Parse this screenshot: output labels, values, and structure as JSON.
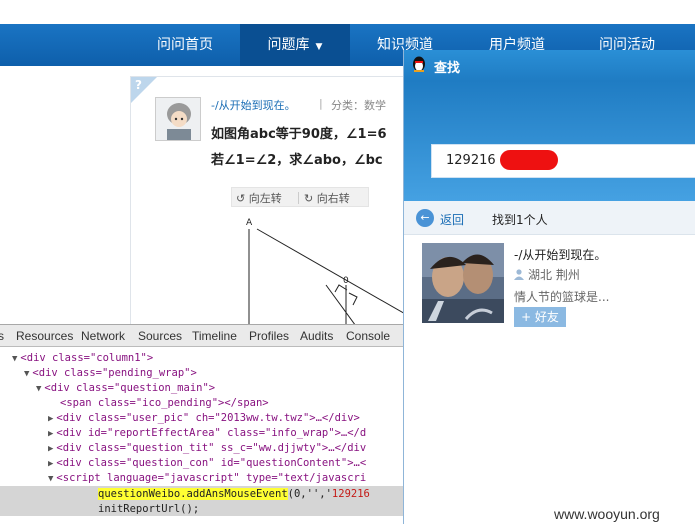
{
  "nav": {
    "items": [
      {
        "label": "问问首页",
        "active": false
      },
      {
        "label": "问题库",
        "active": true,
        "dropdown": true
      },
      {
        "label": "知识频道",
        "active": false
      },
      {
        "label": "用户频道",
        "active": false
      },
      {
        "label": "问问活动",
        "active": false
      }
    ],
    "dropdown_glyph": "▼"
  },
  "question": {
    "pending_mark": "?",
    "user_name": "-/从开始到现在。",
    "separator": "|",
    "category": "分类：数学",
    "line1": "如图角abc等于90度，∠1=6",
    "line2": "若∠1=∠2，求∠abo，∠bc",
    "rotate_left": "向左转",
    "rotate_right": "向右转",
    "rotate_left_icon": "↺",
    "rotate_right_icon": "↻",
    "figure_labels": {
      "a": "A",
      "o": "0"
    }
  },
  "devtools": {
    "tabs": [
      "s",
      "Resources",
      "Network",
      "Sources",
      "Timeline",
      "Profiles",
      "Audits",
      "Console"
    ],
    "lines": [
      {
        "tri": "▼",
        "html": "<div class=\"column1\">"
      },
      {
        "tri": "▼",
        "html": "<div class=\"pending_wrap\">"
      },
      {
        "tri": "▼",
        "html": "<div class=\"question_main\">"
      },
      {
        "tri": "",
        "html": "<span class=\"ico_pending\"></span>"
      },
      {
        "tri": "▶",
        "html": "<div class=\"user_pic\" ch=\"2013ww.tw.twz\">…</div>"
      },
      {
        "tri": "▶",
        "html": "<div id=\"reportEffectArea\" class=\"info_wrap\">…</d"
      },
      {
        "tri": "▶",
        "html": "<div class=\"question_tit\" ss_c=\"ww.djjwty\">…</div"
      },
      {
        "tri": "▶",
        "html": "<div class=\"question_con\" id=\"questionContent\">…<"
      },
      {
        "tri": "▼",
        "html": "<script language=\"javascript\" type=\"text/javascri"
      }
    ],
    "js_highlight": "questionWeibo.addAnsMouseEvent",
    "js_args_prefix": "(0,'','",
    "js_args_value": "129216",
    "js_line2": "initReportUrl();"
  },
  "qq_search": {
    "title": "查找",
    "query": "129216",
    "back_label": "返回",
    "back_glyph": "←",
    "found_text": "找到1个人",
    "result": {
      "name": "-/从开始到现在。",
      "location": "湖北 荆州",
      "signature": "情人节的篮球是...",
      "add_button": "+ 好友"
    }
  },
  "watermark": "www.wooyun.org",
  "colors": {
    "nav_bg": "#1a74c3",
    "qq_title": "#2a8fd6",
    "link_blue": "#1a6db5",
    "highlight": "#ffff33",
    "redact": "#ee1111"
  }
}
